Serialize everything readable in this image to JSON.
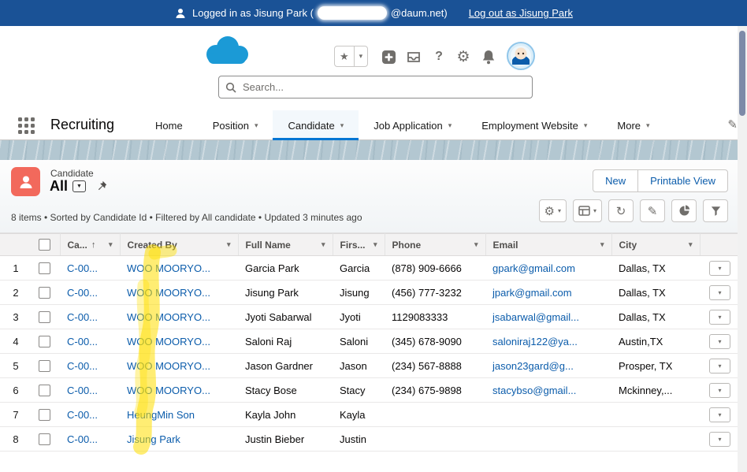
{
  "colors": {
    "accent": "#0176d3",
    "topbar": "#1a5296",
    "entity_icon": "#f2695c",
    "link": "#0b5cab",
    "highlight": "#ffdf00"
  },
  "topbar": {
    "logged_in_prefix": "Logged in as Jisung Park (",
    "email_suffix": "@daum.net)",
    "logout_label": "Log out as Jisung Park"
  },
  "header": {
    "search_placeholder": "Search..."
  },
  "icons": {
    "star": "★",
    "chevron_down": "▾",
    "triangle_down": "▼",
    "help": "?",
    "gear": "⚙",
    "refresh": "↻",
    "pencil": "✎",
    "sort_asc": "↑"
  },
  "nav": {
    "app_name": "Recruiting",
    "tabs": [
      {
        "label": "Home",
        "active": false
      },
      {
        "label": "Position",
        "active": false
      },
      {
        "label": "Candidate",
        "active": true
      },
      {
        "label": "Job Application",
        "active": false
      },
      {
        "label": "Employment Website",
        "active": false
      },
      {
        "label": "More",
        "active": false
      }
    ]
  },
  "list_header": {
    "entity_label": "Candidate",
    "view_label": "All",
    "new_button": "New",
    "printable_button": "Printable View",
    "status": "8 items • Sorted by Candidate Id • Filtered by All candidate • Updated 3 minutes ago"
  },
  "table": {
    "headers": [
      "Ca...",
      "Created By",
      "Full Name",
      "Firs...",
      "Phone",
      "Email",
      "City"
    ],
    "rows": [
      {
        "num": "1",
        "id": "C-00...",
        "created_by": "WOO MOORYO...",
        "full_name": "Garcia Park",
        "first": "Garcia",
        "phone": "(878) 909-6666",
        "email": "gpark@gmail.com",
        "city": "Dallas, TX"
      },
      {
        "num": "2",
        "id": "C-00...",
        "created_by": "WOO MOORYO...",
        "full_name": "Jisung Park",
        "first": "Jisung",
        "phone": "(456) 777-3232",
        "email": "jpark@gmail.com",
        "city": "Dallas, TX"
      },
      {
        "num": "3",
        "id": "C-00...",
        "created_by": "WOO MOORYO...",
        "full_name": "Jyoti Sabarwal",
        "first": "Jyoti",
        "phone": "1129083333",
        "email": "jsabarwal@gmail...",
        "city": "Dallas, TX"
      },
      {
        "num": "4",
        "id": "C-00...",
        "created_by": "WOO MOORYO...",
        "full_name": "Saloni Raj",
        "first": "Saloni",
        "phone": "(345) 678-9090",
        "email": "saloniraj122@ya...",
        "city": "Austin,TX"
      },
      {
        "num": "5",
        "id": "C-00...",
        "created_by": "WOO MOORYO...",
        "full_name": "Jason Gardner",
        "first": "Jason",
        "phone": "(234) 567-8888",
        "email": "jason23gard@g...",
        "city": "Prosper, TX"
      },
      {
        "num": "6",
        "id": "C-00...",
        "created_by": "WOO MOORYO...",
        "full_name": "Stacy Bose",
        "first": "Stacy",
        "phone": "(234) 675-9898",
        "email": "stacybso@gmail...",
        "city": "Mckinney,..."
      },
      {
        "num": "7",
        "id": "C-00...",
        "created_by": "HeungMin Son",
        "full_name": "Kayla John",
        "first": "Kayla",
        "phone": "",
        "email": "",
        "city": ""
      },
      {
        "num": "8",
        "id": "C-00...",
        "created_by": "Jisung Park",
        "full_name": "Justin Bieber",
        "first": "Justin",
        "phone": "",
        "email": "",
        "city": ""
      }
    ]
  }
}
